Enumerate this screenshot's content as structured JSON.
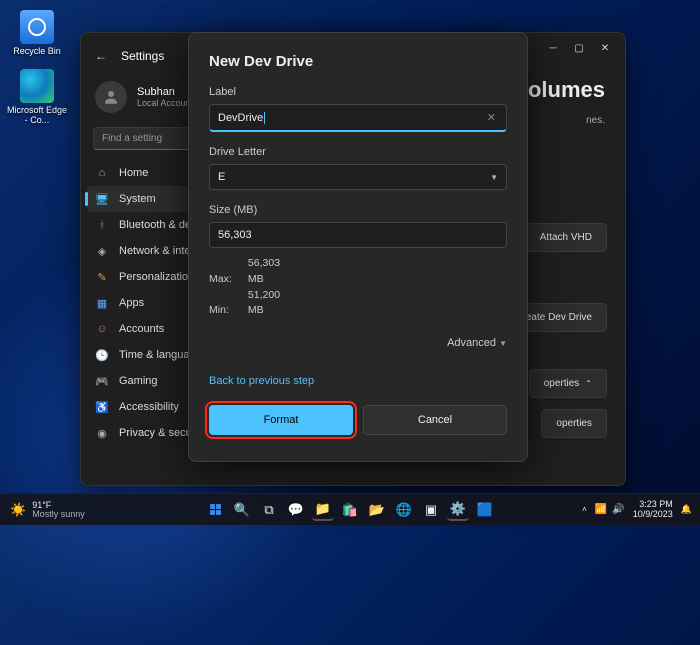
{
  "desktop": {
    "recycle": "Recycle Bin",
    "edge": "Microsoft Edge - Co..."
  },
  "settings": {
    "title": "Settings",
    "user_name": "Subhan",
    "user_sub": "Local Account",
    "search_placeholder": "Find a setting",
    "volumes_heading": "volumes",
    "volumes_sub": "nes.",
    "attach_vhd": "Attach VHD",
    "create_dev_drive": "Create Dev Drive",
    "properties1": "operties",
    "properties2": "operties",
    "side": {
      "home": "Home",
      "system": "System",
      "bluetooth": "Bluetooth & devices",
      "network": "Network & internet",
      "personalization": "Personalization",
      "apps": "Apps",
      "accounts": "Accounts",
      "time": "Time & language",
      "gaming": "Gaming",
      "accessibility": "Accessibility",
      "privacy": "Privacy & security"
    }
  },
  "dialog": {
    "title": "New Dev Drive",
    "label_lbl": "Label",
    "label_val": "DevDrive",
    "letter_lbl": "Drive Letter",
    "letter_val": "E",
    "size_lbl": "Size (MB)",
    "size_val": "56,303",
    "max_lbl": "Max:",
    "max_val": "56,303 MB",
    "min_lbl": "Min:",
    "min_val": "51,200 MB",
    "advanced": "Advanced",
    "back": "Back to previous step",
    "format": "Format",
    "cancel": "Cancel"
  },
  "taskbar": {
    "temp": "91°F",
    "temp_sub": "Mostly sunny",
    "time": "3:23 PM",
    "date": "10/9/2023"
  }
}
